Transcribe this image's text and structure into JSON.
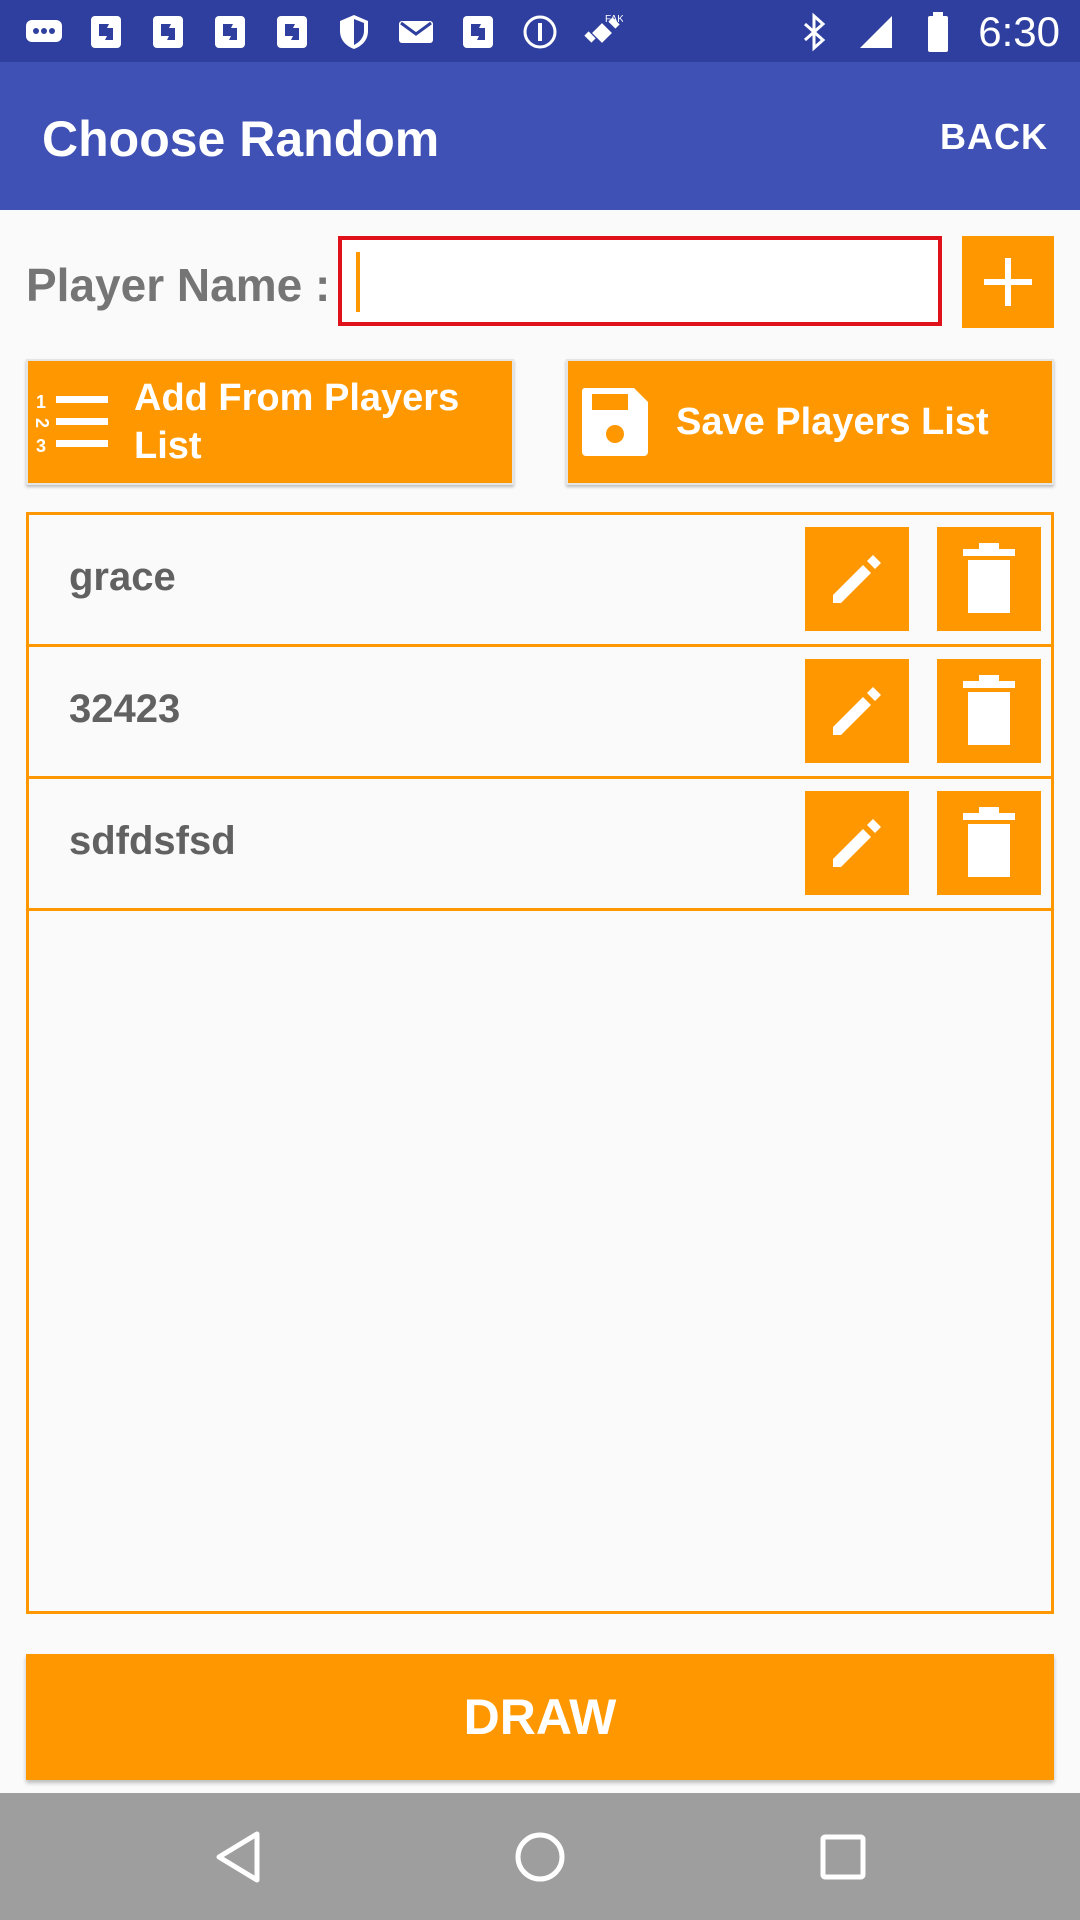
{
  "status_bar": {
    "time": "6:30",
    "icons": [
      "chat-icon",
      "flag-icon",
      "flag-icon",
      "flag-icon",
      "flag-icon",
      "shield-icon",
      "mail-icon",
      "flag-icon",
      "info-icon",
      "satellite-icon",
      "bluetooth-icon",
      "signal-icon",
      "battery-icon"
    ]
  },
  "app_bar": {
    "title": "Choose Random",
    "back_label": "BACK",
    "color": "#3f51b5"
  },
  "player_name": {
    "label": "Player Name :",
    "value": ""
  },
  "buttons": {
    "add_from_list": "Add From Players List",
    "save_list": "Save Players List",
    "draw": "DRAW"
  },
  "players": [
    {
      "name": "grace"
    },
    {
      "name": "32423"
    },
    {
      "name": "sdfdsfsd"
    }
  ],
  "colors": {
    "accent": "#ff9800",
    "input_border": "#e0111b"
  }
}
